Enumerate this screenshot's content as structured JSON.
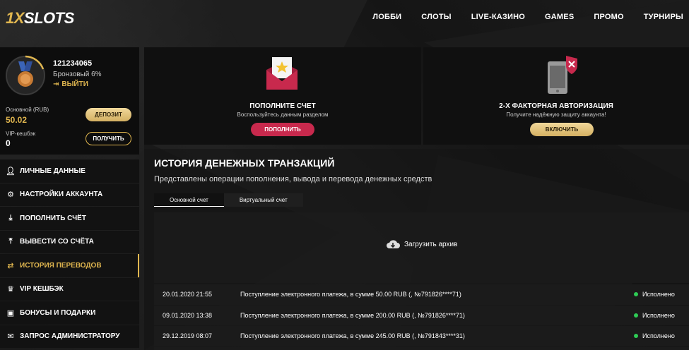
{
  "brand": {
    "logo_one": "1X",
    "logo_rest": "SLOTS"
  },
  "nav": [
    "ЛОББИ",
    "СЛОТЫ",
    "LIVE-КАЗИНО",
    "GAMES",
    "ПРОМО",
    "ТУРНИРЫ"
  ],
  "profile": {
    "user_id": "121234065",
    "level": "Бронзовый 6%",
    "logout": "ВЫЙТИ",
    "balance_label": "Основной (RUB)",
    "balance_value": "50.02",
    "vip_label": "VIP-кешбэк",
    "vip_value": "0",
    "deposit_button": "ДЕПОЗИТ",
    "receive_button": "ПОЛУЧИТЬ"
  },
  "menu": [
    {
      "label": "ЛИЧНЫЕ ДАННЫЕ",
      "icon": "user-icon"
    },
    {
      "label": "НАСТРОЙКИ АККАУНТА",
      "icon": "gears-icon"
    },
    {
      "label": "ПОПОЛНИТЬ СЧЁТ",
      "icon": "download-icon"
    },
    {
      "label": "ВЫВЕСТИ СО СЧЁТА",
      "icon": "upload-icon"
    },
    {
      "label": "ИСТОРИЯ ПЕРЕВОДОВ",
      "icon": "transfer-icon",
      "active": true
    },
    {
      "label": "VIP КЕШБЭК",
      "icon": "crown-icon"
    },
    {
      "label": "БОНУСЫ И ПОДАРКИ",
      "icon": "gift-icon"
    },
    {
      "label": "ЗАПРОС АДМИНИСТРАТОРУ",
      "icon": "mail-icon"
    }
  ],
  "card_deposit": {
    "title": "ПОПОЛНИТЕ СЧЕТ",
    "subtitle": "Воспользуйтесь данным разделом",
    "button": "ПОПОЛНИТЬ"
  },
  "card_2fa": {
    "title": "2-Х ФАКТОРНАЯ АВТОРИЗАЦИЯ",
    "subtitle": "Получите надёжную защиту аккаунта!",
    "button": "ВКЛЮЧИТЬ"
  },
  "history": {
    "title": "ИСТОРИЯ ДЕНЕЖНЫХ ТРАНЗАКЦИЙ",
    "subtitle": "Представлены операции пополнения, вывода и перевода денежных средств",
    "tabs": [
      "Основной счет",
      "Виртуальный счет"
    ],
    "archive": "Загрузить архив",
    "rows": [
      {
        "date": "20.01.2020 21:55",
        "desc": "Поступление электронного платежа, в сумме 50.00 RUB (, №791826****71)",
        "status": "Исполнено"
      },
      {
        "date": "09.01.2020 13:38",
        "desc": "Поступление электронного платежа, в сумме 200.00 RUB (, №791826****71)",
        "status": "Исполнено"
      },
      {
        "date": "29.12.2019 08:07",
        "desc": "Поступление электронного платежа, в сумме 245.00 RUB (, №791843****31)",
        "status": "Исполнено"
      }
    ]
  },
  "colors": {
    "accent": "#e0b64f",
    "pink": "#c8294d",
    "success": "#2ecc55"
  }
}
